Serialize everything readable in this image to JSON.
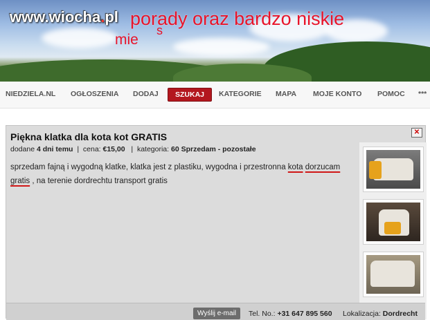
{
  "banner": {
    "logo_text": "www.wiocha",
    "logo_dot": ".",
    "logo_tld": "pl",
    "headline_line1": "porady oraz bardzo niskie",
    "headline_line2": "mie",
    "headline_s": "s"
  },
  "nav": {
    "items": [
      {
        "label": "NIEDZIELA.NL"
      },
      {
        "label": "OGŁOSZENIA"
      },
      {
        "label": "DODAJ"
      },
      {
        "label": "SZUKAJ",
        "active": true
      },
      {
        "label": "KATEGORIE"
      },
      {
        "label": "MAPA"
      },
      {
        "label": "MOJE KONTO"
      },
      {
        "label": "POMOC"
      },
      {
        "label": "***"
      }
    ]
  },
  "listing": {
    "title": "Piękna klatka dla kota kot GRATIS",
    "meta": {
      "added_label": "dodane",
      "added_value": "4 dni temu",
      "price_label": "cena:",
      "price_value": "€15,00",
      "category_label": "kategoria:",
      "category_value": "60 Sprzedam - pozostałe"
    },
    "description": {
      "part1": "sprzedam fajną i wygodną klatke, klatka jest z plastiku, wygodna  i przestronna ",
      "underlined1": "kota",
      "underlined2": "dorzucam gratis",
      "part2": " , na terenie dordrechtu transport gratis"
    },
    "footer": {
      "email_button": "Wyślij e-mail",
      "phone_label": "Tel. No.:",
      "phone_value": "+31 647 895 560",
      "location_label": "Lokalizacja:",
      "location_value": "Dordrecht"
    }
  },
  "colors": {
    "accent": "#b3171e",
    "headline": "#e8142a",
    "underline": "#d01717"
  }
}
